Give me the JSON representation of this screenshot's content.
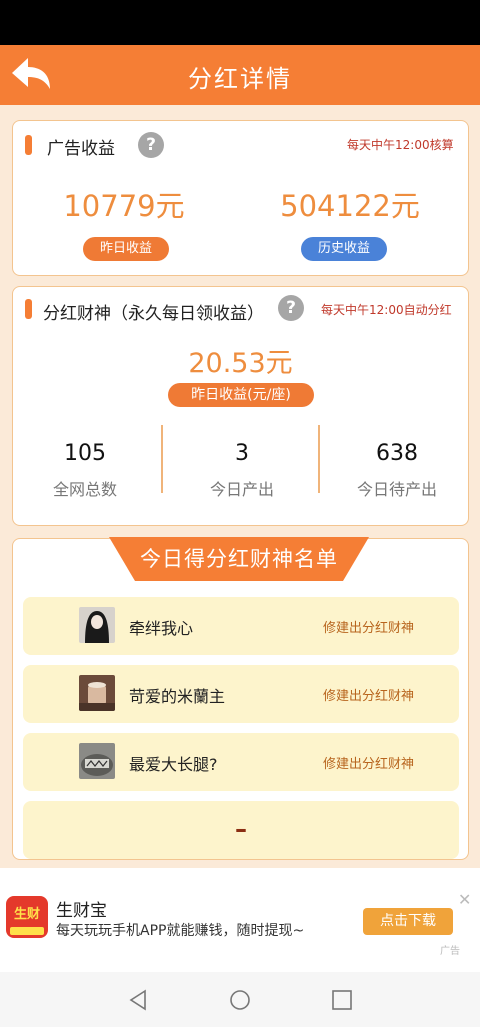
{
  "header": {
    "title": "分红详情"
  },
  "ad_income": {
    "title": "广告收益",
    "note": "每天中午12:00核算",
    "yesterday_value": "10779元",
    "yesterday_label": "昨日收益",
    "history_value": "504122元",
    "history_label": "历史收益"
  },
  "dividend": {
    "title": "分红财神（永久每日领收益）",
    "note": "每天中午12:00自动分红",
    "value": "20.53元",
    "value_label": "昨日收益(元/座)",
    "stats": [
      {
        "value": "105",
        "label": "全网总数"
      },
      {
        "value": "3",
        "label": "今日产出"
      },
      {
        "value": "638",
        "label": "今日待产出"
      }
    ]
  },
  "list": {
    "banner": "今日得分红财神名单",
    "items": [
      {
        "name": "牵绊我心",
        "action": "修建出分红财神"
      },
      {
        "name": "苛爱的米蘭主",
        "action": "修建出分红财神"
      },
      {
        "name": "最爱大长腿?",
        "action": "修建出分红财神"
      }
    ],
    "empty_mark": "–"
  },
  "ad": {
    "logo_text": "生财",
    "title": "生财宝",
    "desc": "每天玩玩手机APP就能赚钱，随时提现~",
    "button": "点击下载",
    "close": "✕",
    "tag": "广告"
  },
  "colors": {
    "accent": "#f57e35",
    "blue": "#4a82d8",
    "row_bg": "#fdf4cc"
  }
}
